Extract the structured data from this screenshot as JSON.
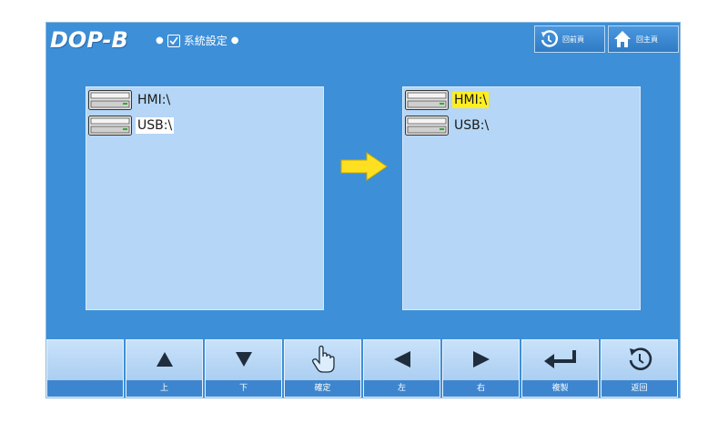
{
  "header": {
    "logo": "DOP-B",
    "breadcrumb_title": "系統設定"
  },
  "header_buttons": {
    "back_label": "回前頁",
    "home_label": "回主頁"
  },
  "source_panel": {
    "drives": [
      {
        "label": "HMI:\\",
        "icon": "drive-icon"
      },
      {
        "label": "USB:\\",
        "icon": "drive-icon"
      }
    ]
  },
  "target_panel": {
    "drives": [
      {
        "label": "HMI:\\",
        "icon": "drive-icon",
        "selected": true
      },
      {
        "label": "USB:\\",
        "icon": "drive-icon"
      }
    ]
  },
  "toolbar": {
    "buttons": [
      {
        "icon": "blank",
        "label": ""
      },
      {
        "icon": "up-triangle-icon",
        "label": "上"
      },
      {
        "icon": "down-triangle-icon",
        "label": "下"
      },
      {
        "icon": "hand-pointer-icon",
        "label": "確定"
      },
      {
        "icon": "left-triangle-icon",
        "label": "左"
      },
      {
        "icon": "right-triangle-icon",
        "label": "右"
      },
      {
        "icon": "enter-icon",
        "label": "複製"
      },
      {
        "icon": "back-icon",
        "label": "返回"
      }
    ]
  },
  "colors": {
    "screen_bg": "#3d8fd8",
    "panel_bg": "#b5d6f6",
    "selection": "#ffee22",
    "arrow": "#ffe020"
  }
}
